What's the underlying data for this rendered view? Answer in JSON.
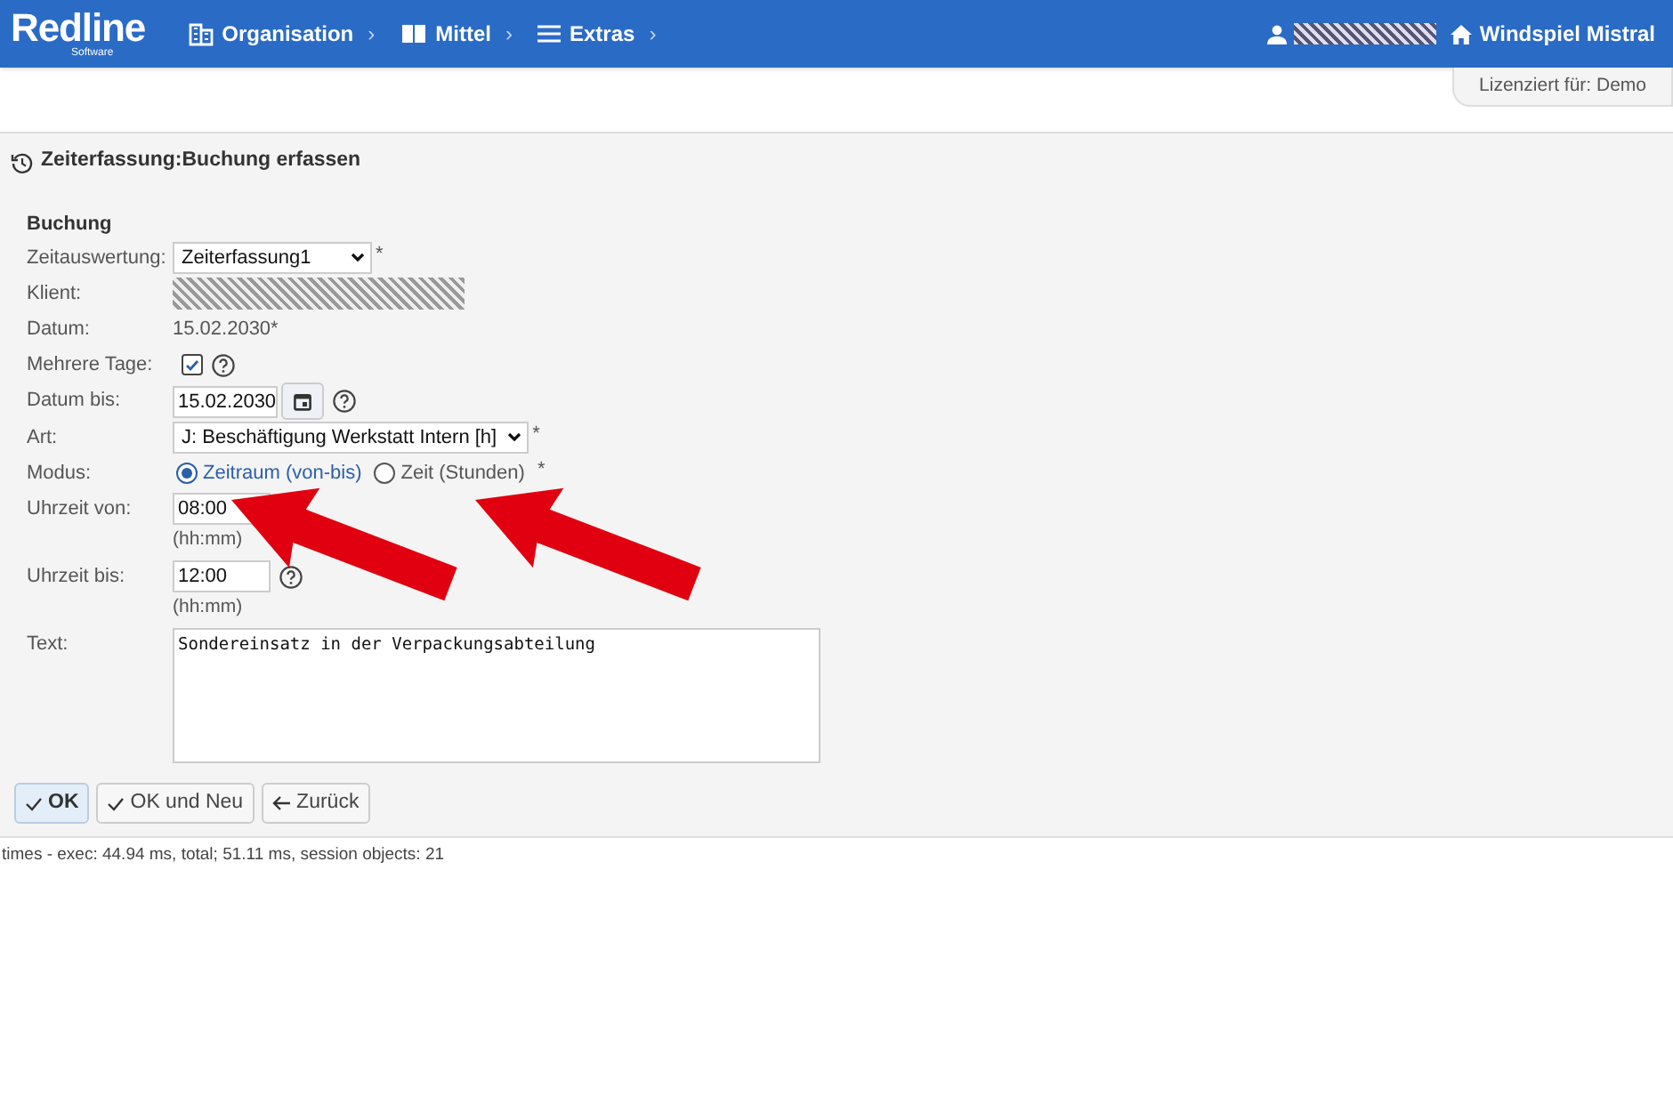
{
  "header": {
    "logo": "Redline",
    "logo_sub": "Software",
    "nav": [
      {
        "label": "Organisation",
        "kind": "building",
        "chevron": "›"
      },
      {
        "label": "Mittel",
        "kind": "book",
        "chevron": "›"
      },
      {
        "label": "Extras",
        "kind": "menu",
        "chevron": "›"
      }
    ],
    "home": "Windspiel Mistral"
  },
  "license": "Lizenziert für: Demo",
  "page_title": "Zeiterfassung:Buchung erfassen",
  "section": "Buchung",
  "fields": [
    {
      "kind": "select",
      "label": "Zeitauswertung:",
      "value": "Zeiterfassung1",
      "required": "*"
    },
    {
      "kind": "redacted",
      "label": "Klient:"
    },
    {
      "kind": "text",
      "label": "Datum:",
      "value": "15.02.2030*"
    },
    {
      "kind": "checkbox",
      "label": "Mehrere Tage:",
      "checked": true,
      "help": true
    },
    {
      "kind": "date",
      "label": "Datum bis:",
      "value": "15.02.2030",
      "help": true
    },
    {
      "kind": "select",
      "label": "Art:",
      "value": "J: Beschäftigung Werkstatt Intern [h]",
      "required": "*"
    },
    {
      "kind": "radio",
      "label": "Modus:",
      "options": [
        {
          "label": "Zeitraum (von-bis)",
          "selected": true
        },
        {
          "label": "Zeit (Stunden)",
          "selected": false
        }
      ],
      "required": "*"
    },
    {
      "kind": "time",
      "label": "Uhrzeit von:",
      "value": "08:00",
      "hint": "(hh:mm)"
    },
    {
      "kind": "time",
      "label": "Uhrzeit bis:",
      "value": "12:00",
      "hint": "(hh:mm)",
      "help": true
    },
    {
      "kind": "textarea",
      "label": "Text:",
      "value": "Sondereinsatz in der Verpackungsabteilung"
    }
  ],
  "buttons": [
    {
      "label": "OK",
      "kind": "confirm",
      "primary": true
    },
    {
      "label": "OK und Neu",
      "kind": "confirm",
      "primary": false
    },
    {
      "label": "Zurück",
      "kind": "back",
      "primary": false
    }
  ],
  "footer": "times - exec: 44.94 ms, total; 51.11 ms, session objects: 21"
}
